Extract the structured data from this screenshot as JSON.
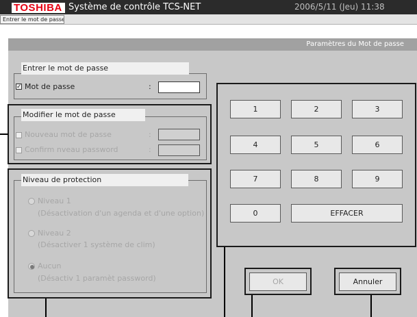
{
  "titlebar": {
    "logo": "TOSHIBA",
    "app_title": "Système de contrôle TCS-NET",
    "datetime": "2006/5/11 (Jeu) 11:38"
  },
  "breadcrumb": "Entrer le mot de passe",
  "subtitle": "Paramètres du Mot de passe",
  "enter_password": {
    "legend": "Entrer le mot de passe",
    "checkbox_label": "Mot de passe",
    "checked": true,
    "colon": ":",
    "value": ""
  },
  "modify_password": {
    "legend": "Modifier le mot de passe",
    "new_label": "Nouveau mot de passe",
    "confirm_label": "Confirm nveau password",
    "colon": ":"
  },
  "protection": {
    "legend": "Niveau de protection",
    "level1_title": "Niveau 1",
    "level1_desc": "(Désactivation d'un agenda et d'une option)",
    "level2_title": "Niveau 2",
    "level2_desc": "(Désactiver 1 système de clim)",
    "none_title": "Aucun",
    "none_desc": "(Désactiv 1 paramèt password)",
    "selected": "Aucun"
  },
  "keypad": {
    "k1": "1",
    "k2": "2",
    "k3": "3",
    "k4": "4",
    "k5": "5",
    "k6": "6",
    "k7": "7",
    "k8": "8",
    "k9": "9",
    "k0": "0",
    "clear": "EFFACER"
  },
  "buttons": {
    "ok": "OK",
    "cancel": "Annuler"
  },
  "colors": {
    "brand_red": "#e60012",
    "titlebar": "#2b2b2b",
    "panel": "#c8c8c8",
    "subtitle_bar": "#a1a1a1"
  }
}
